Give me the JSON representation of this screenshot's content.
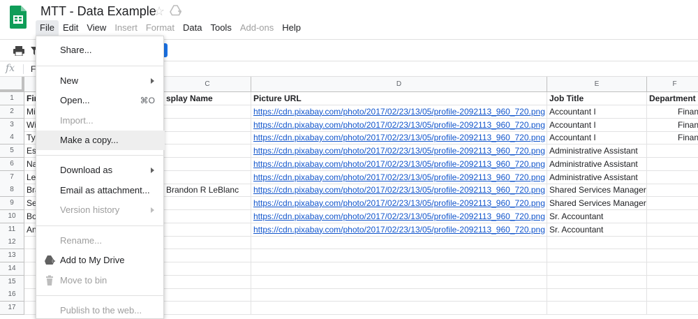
{
  "app": {
    "doc_title": "MTT - Data Example"
  },
  "menubar": [
    {
      "label": "File",
      "state": "active"
    },
    {
      "label": "Edit",
      "state": "enabled"
    },
    {
      "label": "View",
      "state": "enabled"
    },
    {
      "label": "Insert",
      "state": "disabled"
    },
    {
      "label": "Format",
      "state": "disabled"
    },
    {
      "label": "Data",
      "state": "enabled"
    },
    {
      "label": "Tools",
      "state": "enabled"
    },
    {
      "label": "Add-ons",
      "state": "disabled"
    },
    {
      "label": "Help",
      "state": "enabled"
    }
  ],
  "formula_bar": {
    "fx_label": "fx",
    "content": "F"
  },
  "file_menu": {
    "items": [
      {
        "label": "Share...",
        "shortcut": "",
        "submenu": false,
        "disabled": false,
        "hover": false,
        "icon": ""
      },
      {
        "label": "New",
        "shortcut": "",
        "submenu": true,
        "disabled": false,
        "hover": false,
        "icon": ""
      },
      {
        "label": "Open...",
        "shortcut": "⌘O",
        "submenu": false,
        "disabled": false,
        "hover": false,
        "icon": ""
      },
      {
        "label": "Import...",
        "shortcut": "",
        "submenu": false,
        "disabled": true,
        "hover": false,
        "icon": ""
      },
      {
        "label": "Make a copy...",
        "shortcut": "",
        "submenu": false,
        "disabled": false,
        "hover": true,
        "icon": ""
      },
      {
        "label": "Download as",
        "shortcut": "",
        "submenu": true,
        "disabled": false,
        "hover": false,
        "icon": ""
      },
      {
        "label": "Email as attachment...",
        "shortcut": "",
        "submenu": false,
        "disabled": false,
        "hover": false,
        "icon": ""
      },
      {
        "label": "Version history",
        "shortcut": "",
        "submenu": true,
        "disabled": true,
        "hover": false,
        "icon": ""
      },
      {
        "label": "Rename...",
        "shortcut": "",
        "submenu": false,
        "disabled": true,
        "hover": false,
        "icon": ""
      },
      {
        "label": "Add to My Drive",
        "shortcut": "",
        "submenu": false,
        "disabled": false,
        "hover": false,
        "icon": "add-to-drive-icon"
      },
      {
        "label": "Move to bin",
        "shortcut": "",
        "submenu": false,
        "disabled": true,
        "hover": false,
        "icon": "trash-icon"
      },
      {
        "label": "Publish to the web...",
        "shortcut": "",
        "submenu": false,
        "disabled": true,
        "hover": false,
        "icon": ""
      }
    ]
  },
  "sheet": {
    "columns": [
      "C",
      "D",
      "E",
      "F"
    ],
    "row_numbers": [
      "1",
      "2",
      "3",
      "4",
      "5",
      "6",
      "7",
      "8",
      "9",
      "10",
      "11",
      "12",
      "13",
      "14",
      "15",
      "16",
      "17"
    ],
    "col_a_fragments": [
      "Fir",
      "Mia",
      "Wi",
      "Ty",
      "Es",
      "Na",
      "Le",
      "Bra",
      "Se",
      "Bo",
      "An"
    ],
    "col_c_values": [
      "splay Name",
      "",
      "",
      "",
      "",
      "",
      "",
      "Brandon R LeBlanc",
      "",
      "",
      ""
    ],
    "header_row": {
      "picture_url": "Picture URL",
      "job_title": "Job Title",
      "department": "Department"
    },
    "picture_urls": [
      "https://cdn.pixabay.com/photo/2017/02/23/13/05/profile-2092113_960_720.png",
      "https://cdn.pixabay.com/photo/2017/02/23/13/05/profile-2092113_960_720.png",
      "https://cdn.pixabay.com/photo/2017/02/23/13/05/profile-2092113_960_720.png",
      "https://cdn.pixabay.com/photo/2017/02/23/13/05/profile-2092113_960_720.png",
      "https://cdn.pixabay.com/photo/2017/02/23/13/05/profile-2092113_960_720.png",
      "https://cdn.pixabay.com/photo/2017/02/23/13/05/profile-2092113_960_720.png",
      "https://cdn.pixabay.com/photo/2017/02/23/13/05/profile-2092113_960_720.png",
      "https://cdn.pixabay.com/photo/2017/02/23/13/05/profile-2092113_960_720.png",
      "https://cdn.pixabay.com/photo/2017/02/23/13/05/profile-2092113_960_720.png",
      "https://cdn.pixabay.com/photo/2017/02/23/13/05/profile-2092113_960_720.png"
    ],
    "job_titles": [
      "Accountant I",
      "Accountant I",
      "Accountant I",
      "Administrative Assistant",
      "Administrative Assistant",
      "Administrative Assistant",
      "Shared Services Manager",
      "Shared Services Manager",
      "Sr. Accountant",
      "Sr. Accountant"
    ],
    "departments": [
      "Finan",
      "Finan",
      "Finan",
      "",
      "",
      "",
      "",
      "",
      "",
      ""
    ]
  },
  "colors": {
    "link": "#1155cc",
    "sheets_green": "#0f9d58",
    "toolbar_blue": "#1a73e8"
  }
}
